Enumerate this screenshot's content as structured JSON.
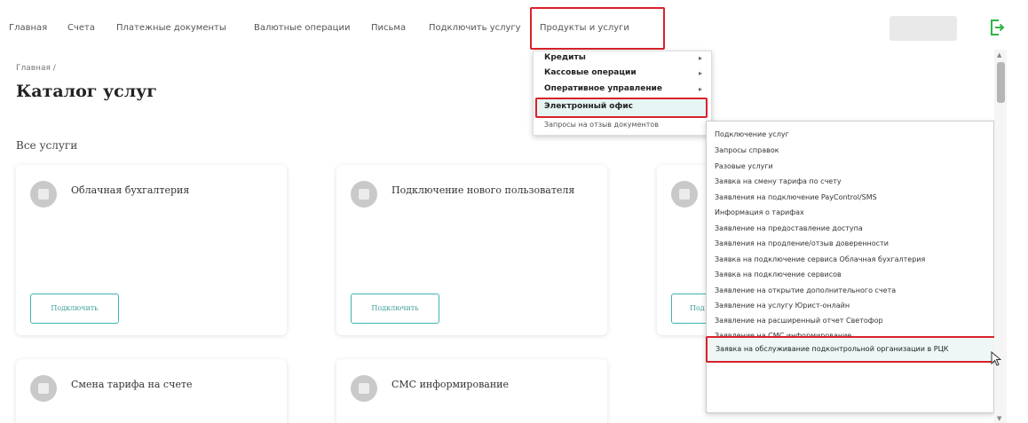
{
  "nav": {
    "items": [
      {
        "label": "Главная"
      },
      {
        "label": "Счета"
      },
      {
        "label": "Платежные документы"
      },
      {
        "label": "Валютные операции"
      },
      {
        "label": "Письма"
      },
      {
        "label": "Подключить услугу"
      },
      {
        "label": "Продукты и услуги"
      }
    ],
    "logout_icon": "logout-icon"
  },
  "page": {
    "breadcrumb": "Главная /",
    "title": "Каталог услуг",
    "section_title": "Все услуги"
  },
  "cards": [
    {
      "title": "Облачная бухгалтерия",
      "button": "Подключить",
      "icon": "service-icon"
    },
    {
      "title": "Подключение нового пользователя",
      "button": "Подключить",
      "icon": "service-icon"
    },
    {
      "title": "",
      "button": "Под",
      "icon": "service-icon"
    },
    {
      "title": "Смена тарифа на счете",
      "icon": "service-icon"
    },
    {
      "title": "СМС информирование",
      "icon": "service-icon"
    }
  ],
  "dropdown": {
    "items": [
      {
        "label": "Кредиты",
        "has_submenu": true
      },
      {
        "label": "Кассовые операции",
        "has_submenu": true
      },
      {
        "label": "Оперативное управление",
        "has_submenu": true
      },
      {
        "label": "Электронный офис",
        "has_submenu": false
      },
      {
        "label": "Запросы на отзыв документов",
        "has_submenu": false
      }
    ]
  },
  "submenu": {
    "items": [
      {
        "label": "Подключение услуг"
      },
      {
        "label": "Запросы справок"
      },
      {
        "label": "Разовые услуги"
      },
      {
        "label": "Заявка на смену тарифа по счету"
      },
      {
        "label": "Заявления на подключение PayControl/SMS"
      },
      {
        "label": "Информация о тарифах"
      },
      {
        "label": "Заявление на предоставление доступа"
      },
      {
        "label": "Заявления на продление/отзыв доверенности"
      },
      {
        "label": "Заявка на подключение сервиса Облачная бухгалтерия"
      },
      {
        "label": "Заявка на подключение сервисов"
      },
      {
        "label": "Заявление на открытие дополнительного счета"
      },
      {
        "label": "Заявление на услугу Юрист-онлайн"
      },
      {
        "label": "Заявление на расширенный отчет Светофор"
      },
      {
        "label": "Заявление на СМС информирование"
      },
      {
        "label": "Заявка на обслуживание подконтрольной организации в РЦК"
      }
    ]
  },
  "colors": {
    "highlight": "#d9222a",
    "accent": "#3fb3ae",
    "logout": "#2fb34a"
  }
}
